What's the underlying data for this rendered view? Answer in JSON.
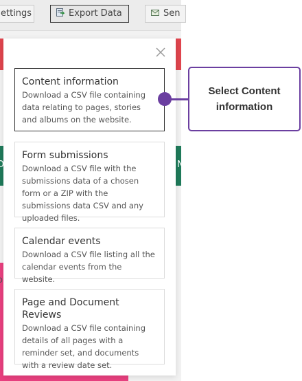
{
  "toolbar": {
    "settings_label": "ettings",
    "export_label": "Export Data",
    "send_label": "Sen"
  },
  "background": {
    "edge_letter_left": "D",
    "edge_letter_right": "N",
    "edge_letter_pink": "o"
  },
  "panel": {
    "options": [
      {
        "title": "Content information",
        "description": "Download a CSV file containing data relating to pages, stories and albums on the website."
      },
      {
        "title": "Form submissions",
        "description": "Download a CSV file with the submissions data of a chosen form or a ZIP with the submissions data CSV and any uploaded files."
      },
      {
        "title": "Calendar events",
        "description": "Download a CSV file listing all the calendar events from the website."
      },
      {
        "title": "Page and Document Reviews",
        "description": "Download a CSV file containing details of all pages with a reminder set, and documents with a review date set."
      }
    ]
  },
  "callout": {
    "text": "Select Content information"
  },
  "icons": {
    "export": "export-icon",
    "send": "send-icon",
    "close": "close-icon"
  },
  "colors": {
    "callout_accent": "#6b3fa0",
    "red_stripe": "#e0454e",
    "green_stripe": "#1f7a5a",
    "pink_block": "#e9407f"
  }
}
